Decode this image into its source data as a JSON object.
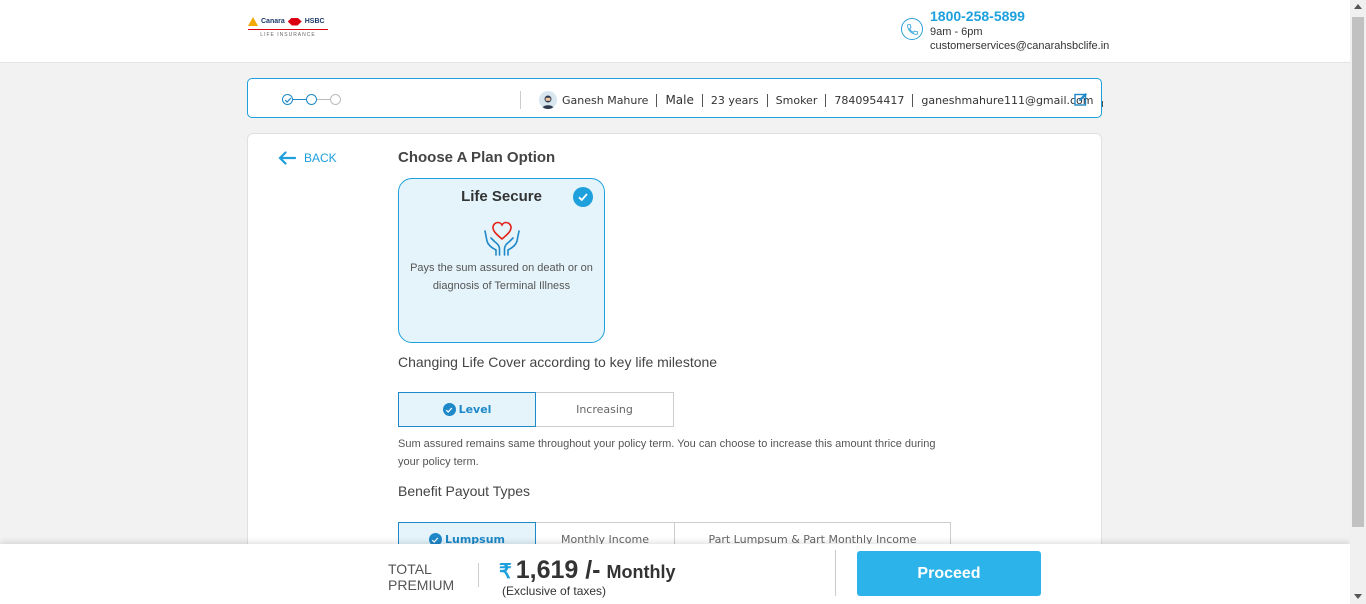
{
  "header": {
    "logo": {
      "brand_left": "Canara",
      "brand_right": "HSBC",
      "tagline": "LIFE INSURANCE"
    },
    "contact": {
      "phone": "1800-258-5899",
      "hours": "9am - 6pm",
      "email": "customerservices@canarahsbclife.in"
    }
  },
  "summary": {
    "name": "Ganesh Mahure",
    "gender": "Male",
    "age": "23 years",
    "smoker": "Smoker",
    "mobile": "7840954417",
    "email": "ganeshmahure111@gmail.com"
  },
  "main": {
    "back_label": "BACK",
    "plan_title": "Choose A Plan Option",
    "plan": {
      "name": "Life Secure",
      "description": "Pays the sum assured on death or on diagnosis of Terminal Illness"
    },
    "cover_title": "Changing Life Cover according to key life milestone",
    "cover_options": [
      "Level",
      "Increasing"
    ],
    "cover_description": "Sum assured remains same throughout your policy term. You can choose to increase this amount thrice during your policy term.",
    "payout_title": "Benefit Payout Types",
    "payout_options": [
      "Lumpsum",
      "Monthly Income",
      "Part Lumpsum & Part Monthly Income"
    ]
  },
  "footer": {
    "total_label_1": "TOTAL",
    "total_label_2": "PREMIUM",
    "currency": "₹",
    "amount": "1,619 /-",
    "frequency": "Monthly",
    "tax_note": "(Exclusive of taxes)",
    "proceed_label": "Proceed"
  },
  "colors": {
    "accent": "#1ea0dd",
    "button": "#2cb4ea",
    "selected_bg": "#e5f4fb"
  },
  "icons": [
    "phone-icon",
    "user-avatar-icon",
    "edit-icon",
    "back-arrow-icon",
    "check-icon",
    "heart-hands-icon"
  ]
}
